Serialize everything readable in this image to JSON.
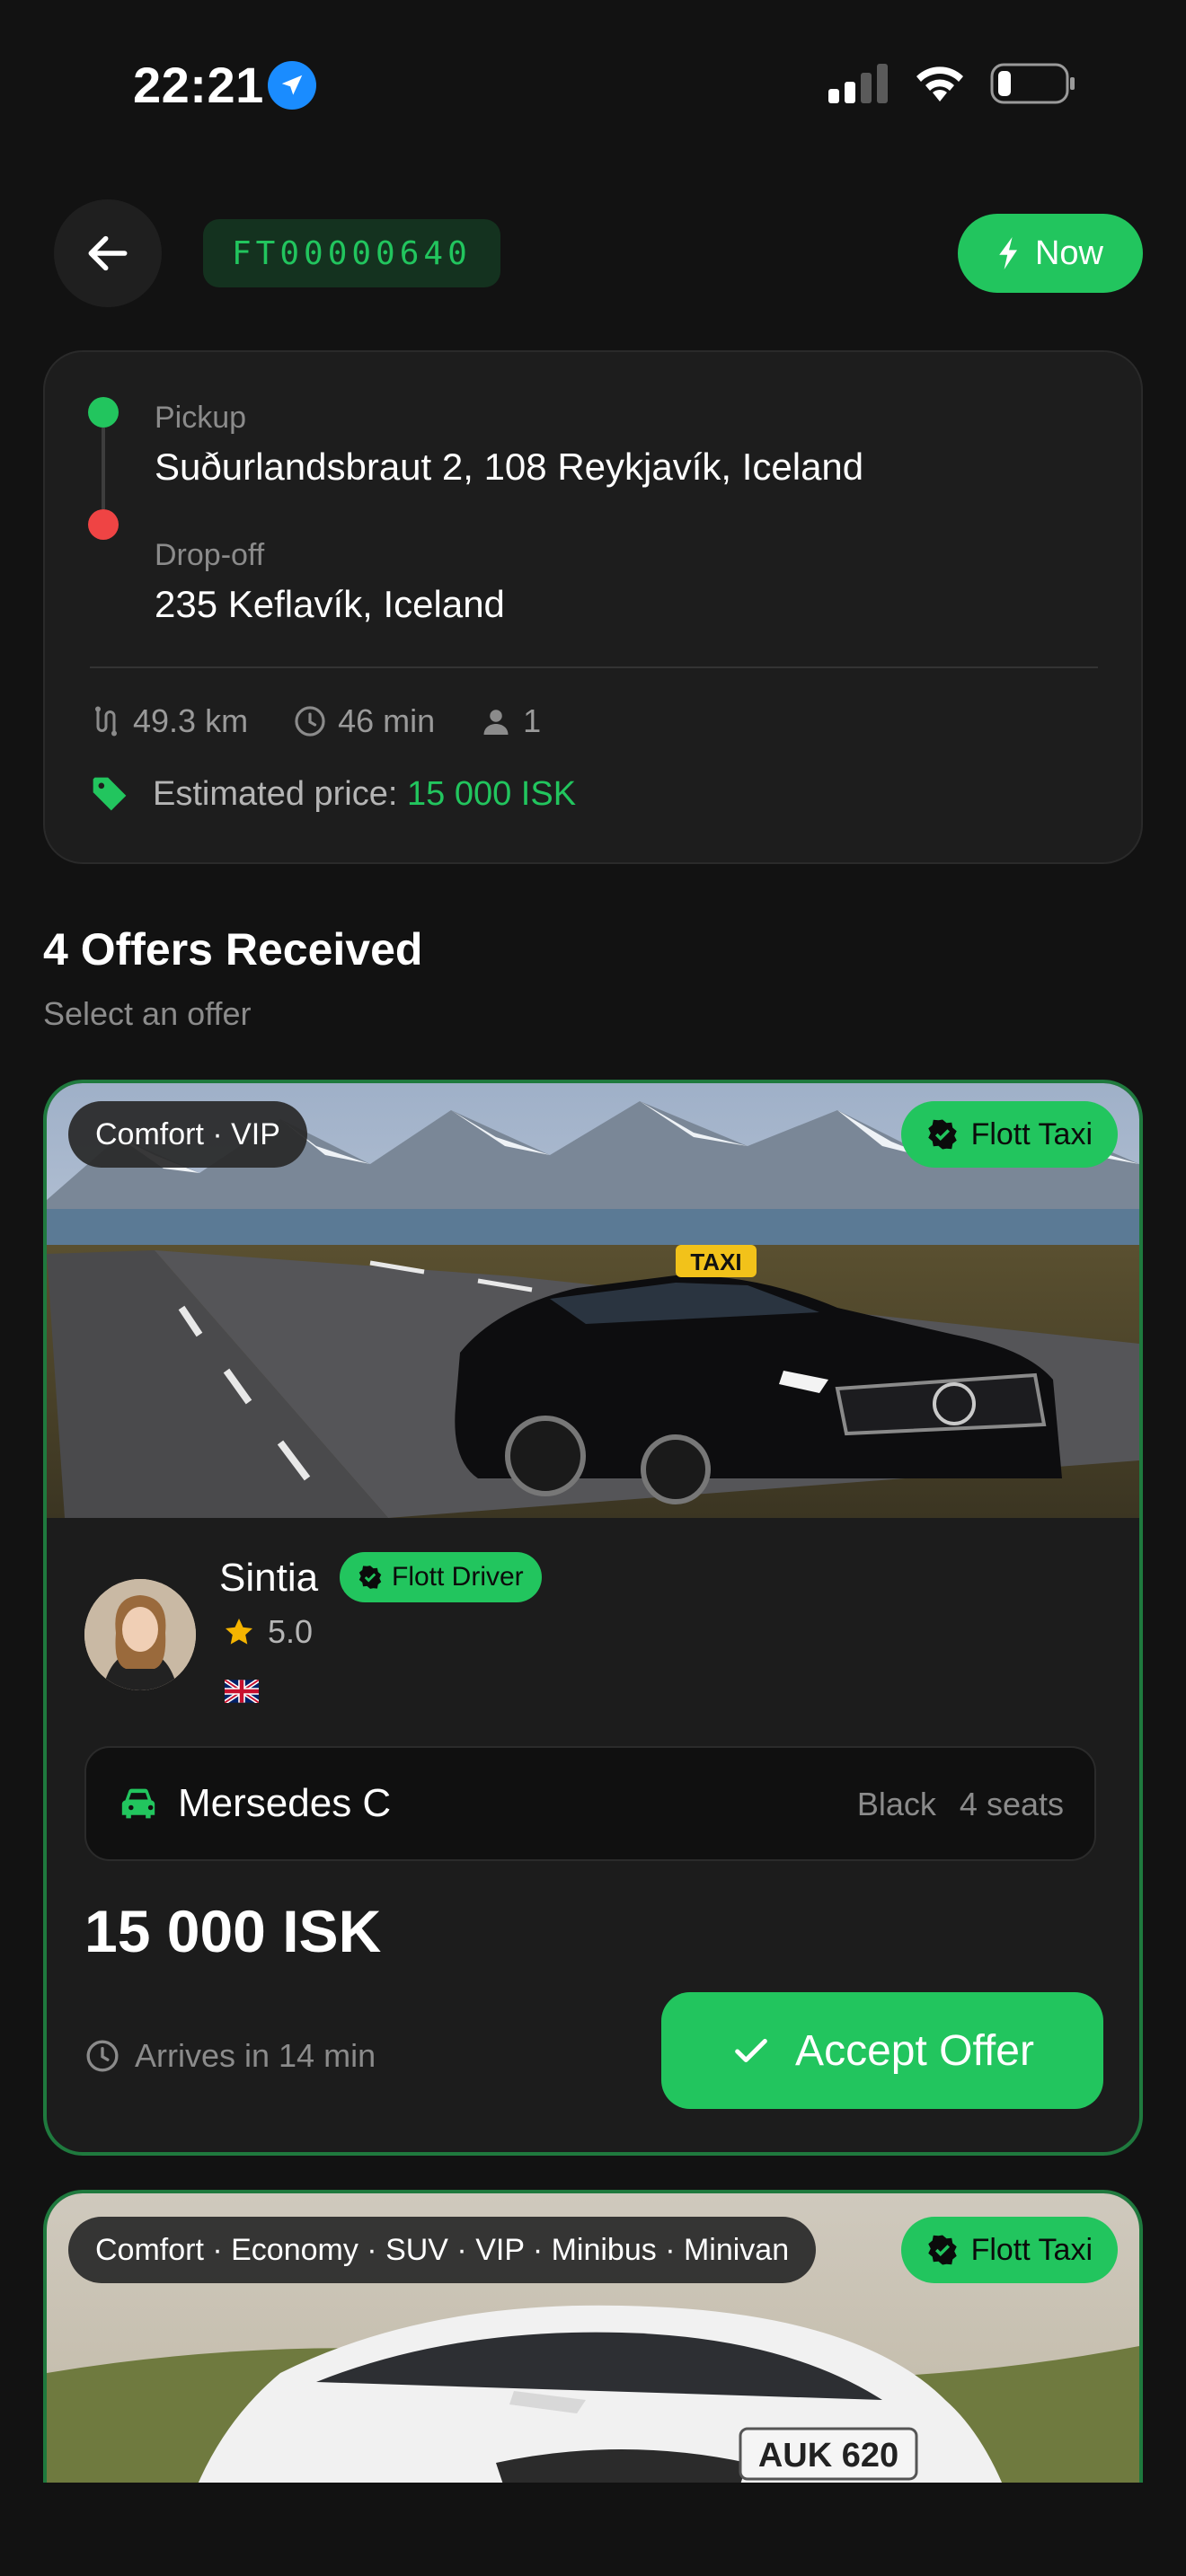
{
  "status_bar": {
    "time": "22:21",
    "location_icon": "location-arrow-icon",
    "signal_icon": "cellular-signal-icon",
    "wifi_icon": "wifi-icon",
    "battery_icon": "battery-low-icon"
  },
  "header": {
    "back_icon": "arrow-left-icon",
    "ride_id": "FT00000640",
    "now_label": "Now",
    "now_icon": "lightning-icon"
  },
  "route": {
    "pickup_label": "Pickup",
    "pickup_address": "Suðurlandsbraut 2, 108 Reykjavík, Iceland",
    "dropoff_label": "Drop-off",
    "dropoff_address": "235 Keflavík, Iceland",
    "distance": "49.3 km",
    "duration": "46 min",
    "passengers": "1",
    "estimated_price_label": "Estimated price:",
    "estimated_price_value": "15 000 ISK"
  },
  "offers": {
    "title": "4 Offers Received",
    "subtitle": "Select an offer",
    "items": [
      {
        "categories": "Comfort · VIP",
        "company": "Flott Taxi",
        "taxi_sign": "TAXI",
        "driver_name": "Sintia",
        "driver_badge": "Flott Driver",
        "rating": "5.0",
        "language_flag": "uk-flag",
        "vehicle_name": "Mersedes C",
        "vehicle_color": "Black",
        "vehicle_seats": "4 seats",
        "price": "15 000 ISK",
        "arrival": "Arrives in 14 min",
        "accept_label": "Accept Offer"
      },
      {
        "categories": "Comfort · Economy · SUV · VIP · Minibus · Minivan",
        "company": "Flott Taxi",
        "plate": "AUK 620"
      }
    ]
  },
  "colors": {
    "accent": "#22c55e",
    "background": "#121212",
    "card": "#1d1d1d",
    "dropoff": "#ef4444"
  }
}
